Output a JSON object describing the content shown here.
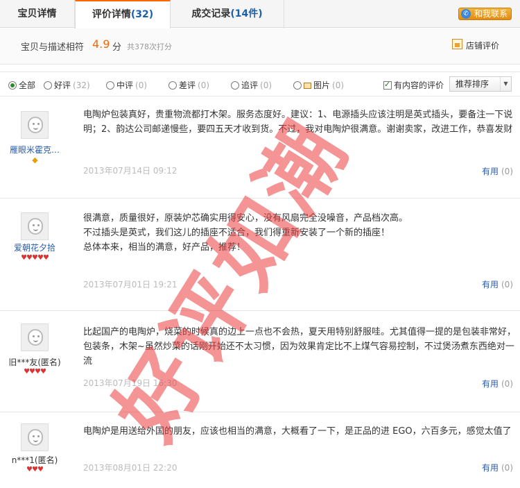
{
  "tabs": [
    {
      "label": "宝贝详情",
      "count": ""
    },
    {
      "label": "评价详情",
      "count": "(32)"
    },
    {
      "label": "成交记录",
      "count": "(14件)"
    }
  ],
  "contact_button": "和我联系",
  "score": {
    "label": "宝贝与描述相符",
    "value": "4.9",
    "unit": "分",
    "count_text": "共378次打分",
    "shop_rating": "店铺评价"
  },
  "filters": {
    "all": {
      "label": "全部",
      "selected": true
    },
    "good": {
      "label": "好评",
      "count": "(32)"
    },
    "neutral": {
      "label": "中评",
      "count": "(0)"
    },
    "bad": {
      "label": "差评",
      "count": "(0)"
    },
    "followup": {
      "label": "追评",
      "count": "(0)"
    },
    "photo": {
      "label": "图片",
      "count": "(0)"
    },
    "has_content": {
      "label": "有内容的评价",
      "checked": true
    },
    "sort": "推荐排序"
  },
  "reviews": [
    {
      "user": "雁眼米霍克…",
      "rank": "◆",
      "lines": [
        "电陶炉包装真好，贵重物流都打木架。服务态度好。建议：1、电源插头应该注明是英式插头，要备注一下说明；2、韵达公司邮递慢些，要四五天才收到货。不过，我对电陶炉很满意。谢谢卖家，改进工作，恭喜发财"
      ],
      "date": "2013年07月14日 09:12",
      "useful_label": "有用",
      "useful_count": "(0)"
    },
    {
      "user": "爱朝花夕拾",
      "rank": "♥♥♥♥♥",
      "lines": [
        "很满意，质量很好，原装炉芯确实用得安心，没有风扇完全没噪音，产品档次高。",
        "不过插头是英式，我们这儿的插座不适合，我们得重新安装了一个新的插座！",
        "总体本来，相当的满意，好产品，推荐！"
      ],
      "date": "2013年07月01日 19:21",
      "useful_label": "有用",
      "useful_count": "(0)"
    },
    {
      "user": "旧***友(匿名)",
      "rank": "♥♥♥♥",
      "lines": [
        "比起国产的电陶炉，烧菜的时候真的边上一点也不会热，夏天用特别舒服哇。尤其值得一提的是包装非常好，包装条，木架~虽然炒菜的话刚开始还不太习惯，因为效果肯定比不上煤气容易控制，不过煲汤煮东西绝对一流"
      ],
      "date": "2013年07月19日 16:30",
      "useful_label": "有用",
      "useful_count": "(0)"
    },
    {
      "user": "n***1(匿名)",
      "rank": "♥♥♥",
      "lines": [
        "电陶炉是用送给外国的朋友，应该也相当的满意，大概看了一下，是正品的进 EGO，六百多元，感觉太值了"
      ],
      "date": "2013年08月01日 22:20",
      "useful_label": "有用",
      "useful_count": "(0)"
    }
  ],
  "watermark": "好评如潮"
}
